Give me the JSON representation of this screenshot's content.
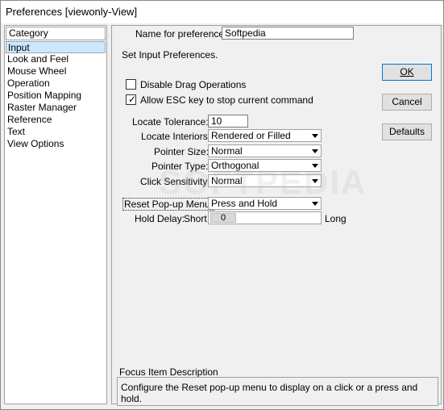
{
  "window": {
    "title": "Preferences [viewonly-View]"
  },
  "category": {
    "header": "Category",
    "items": [
      {
        "label": "Input",
        "selected": true
      },
      {
        "label": "Look and Feel"
      },
      {
        "label": "Mouse Wheel"
      },
      {
        "label": "Operation"
      },
      {
        "label": "Position Mapping"
      },
      {
        "label": "Raster Manager"
      },
      {
        "label": "Reference"
      },
      {
        "label": "Text"
      },
      {
        "label": "View Options"
      }
    ]
  },
  "prefs_name": {
    "label": "Name for preferences",
    "value": "Softpedia"
  },
  "section_title": "Set Input Preferences.",
  "options": {
    "disable_drag": {
      "label": "Disable Drag Operations",
      "checked": false
    },
    "allow_esc": {
      "label": "Allow ESC key to stop current command",
      "checked": true
    }
  },
  "fields": {
    "locate_tolerance": {
      "label": "Locate Tolerance:",
      "value": "10"
    },
    "locate_interiors": {
      "label": "Locate Interiors:",
      "value": "Rendered or Filled"
    },
    "pointer_size": {
      "label": "Pointer Size:",
      "value": "Normal"
    },
    "pointer_type": {
      "label": "Pointer Type:",
      "value": "Orthogonal"
    },
    "click_sensitivity": {
      "label": "Click Sensitivity:",
      "value": "Normal"
    },
    "reset_popup": {
      "label": "Reset Pop-up Menu:",
      "value": "Press and Hold"
    },
    "hold_delay": {
      "label": "Hold Delay:",
      "min_label": "Short",
      "value": "0",
      "max_label": "Long"
    }
  },
  "buttons": {
    "ok": "OK",
    "cancel": "Cancel",
    "defaults": "Defaults"
  },
  "focus": {
    "title": "Focus Item Description",
    "text": "Configure the Reset pop-up menu to display on a click or a press and hold."
  },
  "watermark": "SOFTPEDIA"
}
